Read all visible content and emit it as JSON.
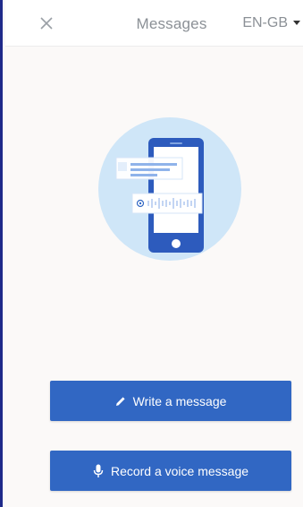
{
  "header": {
    "close_icon": "close-icon",
    "title": "Messages",
    "language": "EN-GB",
    "language_dropdown_icon": "caret-down-icon"
  },
  "illustration": {
    "icon": "phone-with-messages-illustration"
  },
  "actions": {
    "write_label": "Write a message",
    "write_icon": "pencil-icon",
    "record_label": "Record a voice message",
    "record_icon": "microphone-icon"
  },
  "colors": {
    "primary": "#3167c3",
    "illustration_circle": "#cfe6f8",
    "phone": "#2d5bbd"
  }
}
